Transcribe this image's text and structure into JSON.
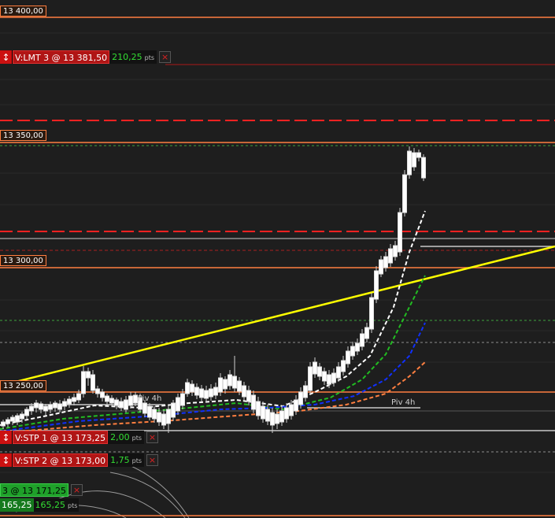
{
  "price_levels": [
    {
      "label": "13 400,00"
    },
    {
      "label": "13 350,00"
    },
    {
      "label": "13 300,00"
    },
    {
      "label": "13 250,00"
    }
  ],
  "orders": [
    {
      "label": "V:LMT  3 @ 13 381,50",
      "pts": "210,25",
      "unit": "pts",
      "arrow": "↕",
      "close": "×"
    },
    {
      "label": "V:STP  1 @ 13 173,25",
      "pts": "2,00",
      "unit": "pts",
      "arrow": "↕",
      "close": "×"
    },
    {
      "label": "V:STP  2 @ 13 173,00",
      "pts": "1,75",
      "unit": "pts",
      "arrow": "↕",
      "close": "×"
    }
  ],
  "position": {
    "label": "3 @ 13 171,25",
    "value1": "165,25",
    "value2": "165,25",
    "unit": "pts",
    "close": "×"
  },
  "pivots": [
    {
      "label": "Piv 4h"
    },
    {
      "label": "Piv 4h"
    }
  ],
  "colors": {
    "background": "#1e1e1e",
    "price_line": "#ff7f40",
    "order_line": "#ff2222",
    "trendline": "#ffff00",
    "ma_fast": "#ffffff",
    "ma_green": "#22bb22",
    "ma_blue": "#1030ff",
    "ma_orange": "#ff7f40",
    "candle_up": "#ffffff",
    "candle_down": "#dddddd"
  }
}
